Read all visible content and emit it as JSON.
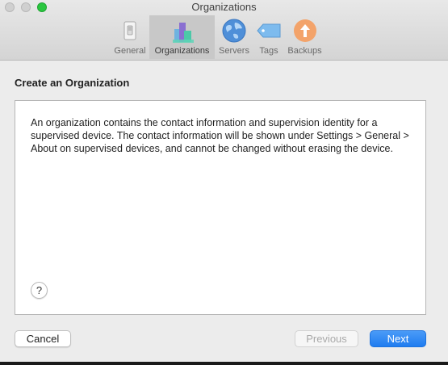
{
  "window": {
    "title": "Organizations"
  },
  "toolbar": {
    "tabs": [
      {
        "label": "General",
        "icon": "switch-icon",
        "selected": false
      },
      {
        "label": "Organizations",
        "icon": "buildings-icon",
        "selected": true
      },
      {
        "label": "Servers",
        "icon": "globe-icon",
        "selected": false
      },
      {
        "label": "Tags",
        "icon": "tag-icon",
        "selected": false
      },
      {
        "label": "Backups",
        "icon": "upload-arrow-icon",
        "selected": false
      }
    ]
  },
  "main": {
    "heading": "Create an Organization",
    "description": "An organization contains the contact information and supervision identity for a supervised device. The contact information will be shown under Settings > General > About on supervised devices, and cannot be changed without erasing the device.",
    "help_label": "?"
  },
  "footer": {
    "cancel_label": "Cancel",
    "previous_label": "Previous",
    "next_label": "Next"
  },
  "colors": {
    "accent": "#1f7cf0",
    "window_background": "#ececec",
    "zoom_button": "#2ac63f"
  }
}
